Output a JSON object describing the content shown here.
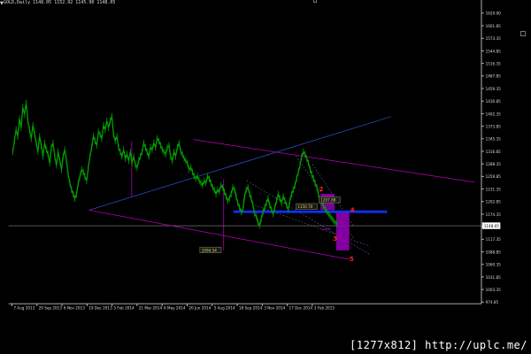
{
  "window": {
    "symbol_title": "GOLD,Daily",
    "ohlc": "1148.05 1152.92 1145.90 1148.05",
    "watermark": "[1277x812] http://uplc.me/"
  },
  "chart_data": {
    "type": "line",
    "title": "GOLD,Daily",
    "xlabel": "",
    "ylabel": "",
    "ylim": [
      968,
      1645
    ],
    "y_ticks": [
      "1629.90",
      "1601.85",
      "1573.35",
      "1544.85",
      "1516.35",
      "1487.85",
      "1459.35",
      "1430.85",
      "1402.35",
      "1373.85",
      "1345.35",
      "1316.85",
      "1288.35",
      "1259.85",
      "1231.35",
      "1202.85",
      "1174.35",
      "1145.85",
      "1117.35",
      "1088.85",
      "1060.35",
      "1031.85",
      "1003.35",
      "974.85"
    ],
    "x_ticks": [
      "7 Aug 2013",
      "20 Sep 2013",
      "6 Nov 2013",
      "19 Dec 2013",
      "5 Feb 2014",
      "21 Mar 2014",
      "6 May 2014",
      "20 Jun 2014",
      "5 Aug 2014",
      "18 Sep 2014",
      "3 Nov 2014",
      "17 Dec 2014",
      "3 Feb 2015"
    ],
    "current_price": "1148.05",
    "series": [
      {
        "color": "#00a000",
        "x": [
          0,
          1,
          2,
          3,
          4,
          5,
          6,
          7,
          8,
          9,
          10,
          11,
          12,
          13,
          14,
          15,
          16,
          17,
          18,
          19,
          20,
          21,
          22,
          23,
          24,
          25,
          26,
          27,
          28,
          29,
          30,
          31,
          32,
          33,
          34,
          35,
          36,
          37,
          38,
          39,
          40,
          41,
          42,
          43,
          44,
          45,
          46,
          47,
          48,
          49,
          50,
          51,
          52,
          53,
          54,
          55,
          56,
          57,
          58,
          59,
          60,
          61,
          62,
          63,
          64,
          65,
          66,
          67,
          68,
          69,
          70,
          71,
          72,
          73,
          74,
          75,
          76,
          77,
          78,
          79,
          80,
          81,
          82,
          83,
          84,
          85,
          86,
          87,
          88,
          89,
          90,
          91,
          92,
          93,
          94,
          95,
          96,
          97,
          98,
          99,
          100,
          101,
          102,
          103,
          104,
          105,
          106,
          107,
          108,
          109,
          110,
          111,
          112,
          113,
          114,
          115,
          116,
          117,
          118,
          119,
          120,
          121,
          122,
          123,
          124,
          125,
          126,
          127,
          128,
          129,
          130,
          131,
          132,
          133,
          134,
          135,
          136,
          137,
          138,
          139,
          140,
          141,
          142,
          143,
          144,
          145,
          146,
          147,
          148,
          149,
          150,
          151,
          152,
          153,
          154,
          155,
          156,
          157,
          158,
          159,
          160,
          161,
          162,
          163,
          164,
          165,
          166,
          167,
          168,
          169,
          170,
          171,
          172,
          173,
          174,
          175,
          176,
          177,
          178,
          179,
          180,
          181,
          182,
          183,
          184,
          185,
          186,
          187,
          188,
          189,
          190,
          191,
          192,
          193
        ],
        "y": [
          1310,
          1335,
          1360,
          1345,
          1385,
          1365,
          1410,
          1395,
          1420,
          1380,
          1360,
          1340,
          1370,
          1350,
          1330,
          1310,
          1345,
          1325,
          1300,
          1330,
          1315,
          1305,
          1285,
          1320,
          1330,
          1300,
          1280,
          1310,
          1290,
          1270,
          1300,
          1315,
          1290,
          1260,
          1240,
          1225,
          1215,
          1205,
          1215,
          1240,
          1255,
          1270,
          1265,
          1255,
          1245,
          1275,
          1300,
          1320,
          1345,
          1335,
          1325,
          1355,
          1350,
          1340,
          1370,
          1360,
          1380,
          1365,
          1380,
          1390,
          1350,
          1335,
          1345,
          1320,
          1310,
          1300,
          1315,
          1295,
          1305,
          1290,
          1310,
          1285,
          1300,
          1280,
          1275,
          1290,
          1300,
          1310,
          1330,
          1320,
          1310,
          1300,
          1320,
          1315,
          1330,
          1320,
          1340,
          1335,
          1325,
          1315,
          1310,
          1305,
          1320,
          1325,
          1300,
          1290,
          1310,
          1300,
          1320,
          1330,
          1310,
          1305,
          1295,
          1290,
          1285,
          1270,
          1275,
          1265,
          1255,
          1250,
          1255,
          1245,
          1240,
          1235,
          1245,
          1240,
          1255,
          1250,
          1240,
          1230,
          1225,
          1215,
          1225,
          1220,
          1235,
          1230,
          1220,
          1210,
          1200,
          1205,
          1215,
          1230,
          1225,
          1210,
          1195,
          1185,
          1175,
          1180,
          1210,
          1225,
          1230,
          1215,
          1205,
          1190,
          1170,
          1165,
          1150,
          1145,
          1160,
          1175,
          1185,
          1195,
          1205,
          1190,
          1180,
          1170,
          1185,
          1200,
          1215,
          1205,
          1195,
          1210,
          1200,
          1190,
          1180,
          1200,
          1215,
          1225,
          1235,
          1250,
          1265,
          1280,
          1300,
          1310,
          1305,
          1295,
          1285,
          1270,
          1260,
          1250,
          1240,
          1230,
          1215,
          1200,
          1195,
          1190,
          1180,
          1175,
          1170,
          1165,
          1160,
          1155,
          1150,
          1148
        ]
      }
    ],
    "annotations": {
      "labels": [
        "1094.54",
        "1150.70",
        "1207.88"
      ],
      "wave_numbers": [
        "2",
        "3",
        "4",
        "5"
      ],
      "wave_color": "#ff2020"
    },
    "colors": {
      "grid_axis": "#c0c0c0",
      "channel": "#c000c0",
      "trend_blue": "#3050d0",
      "hline": "#1030ff",
      "box": "#9000b0"
    }
  }
}
